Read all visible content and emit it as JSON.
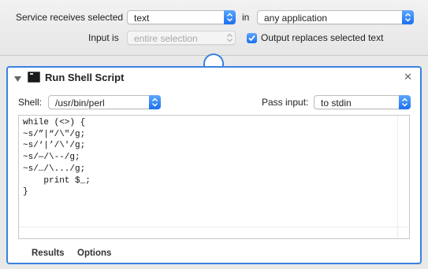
{
  "header": {
    "service_label": "Service receives selected",
    "service_value": "text",
    "in_label": "in",
    "app_value": "any application",
    "input_is_label": "Input is",
    "input_is_value": "entire selection",
    "output_replaces_label": "Output replaces selected text",
    "output_replaces_checked": true
  },
  "action": {
    "title": "Run Shell Script",
    "shell_label": "Shell:",
    "shell_value": "/usr/bin/perl",
    "pass_input_label": "Pass input:",
    "pass_input_value": "to stdin",
    "code": "while (<>) {\n~s/”|“/\\\"/g;\n~s/‘|’/\\'/g;\n~s/—/\\--/g;\n~s/…/\\.../g;\n    print $_;\n}"
  },
  "footer_tabs": [
    "Results",
    "Options"
  ],
  "colors": {
    "accent": "#3b82e0",
    "stepper": "#1d6ff0"
  },
  "icons": {
    "disclosure": "disclosure-triangle-icon",
    "terminal": "terminal-icon",
    "close": "close-icon",
    "stepper": "up-down-chevron-icon",
    "checkbox": "checkmark-icon"
  }
}
